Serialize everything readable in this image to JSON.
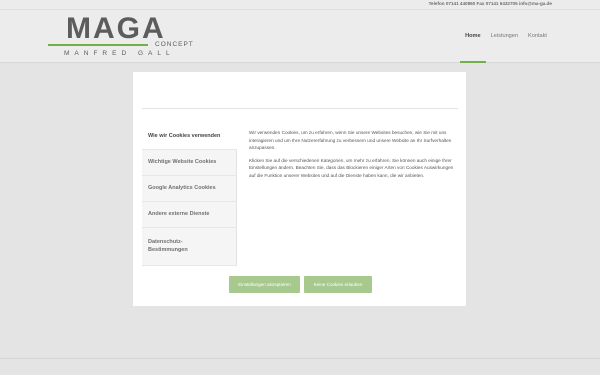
{
  "topbar": {
    "contact": "Telefon 07141 440860  Fax 07141 6432705  info@ma-ga.de"
  },
  "logo": {
    "main": "MAGA",
    "sub": "CONCEPT",
    "owner": "MANFRED GALL"
  },
  "nav": [
    {
      "label": "Home",
      "active": true
    },
    {
      "label": "Leistungen",
      "active": false
    },
    {
      "label": "Kontakt",
      "active": false
    }
  ],
  "cookie_modal": {
    "tabs": [
      {
        "label": "Wie wir Cookies verwenden",
        "active": true
      },
      {
        "label": "Wichtige Website Cookies",
        "active": false
      },
      {
        "label": "Google Analytics Cookies",
        "active": false
      },
      {
        "label": "Andere externe Dienste",
        "active": false
      },
      {
        "label": "Datenschutz-Bestimmungen",
        "active": false
      }
    ],
    "paragraphs": [
      "Wir verwenden Cookies, um zu erfahren, wenn Sie unsere Websites besuchen, wie Sie mit uns interagieren und um Ihre Nutzererfahrung zu verbessern und unsere Website an Ihr Surfverhalten anzupassen.",
      "Klicken Sie auf die verschiedenen Kategorien, um mehr zu erfahren. Sie können auch einige Ihrer Einstellungen ändern. Beachten Sie, dass das Blockieren einiger Arten von Cookies Auswirkungen auf die Funktion unserer Websites und auf die Dienste haben kann, die wir anbieten."
    ],
    "buttons": {
      "settings": "Einstellungen akzeptieren",
      "allow": "Keine Cookies erlauben"
    }
  },
  "colors": {
    "accent": "#72b04a",
    "button": "#a8c98e"
  }
}
